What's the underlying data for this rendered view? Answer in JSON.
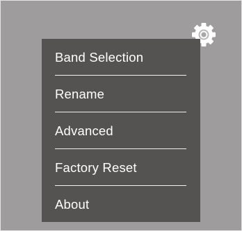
{
  "settings_icon": "gear-icon",
  "menu": {
    "items": [
      {
        "label": "Band Selection"
      },
      {
        "label": "Rename"
      },
      {
        "label": "Advanced"
      },
      {
        "label": "Factory Reset"
      },
      {
        "label": "About"
      }
    ]
  },
  "colors": {
    "frame_background": "#9e9c9d",
    "menu_background": "#555352",
    "menu_text": "#ffffff",
    "divider": "#f2f2f2"
  }
}
